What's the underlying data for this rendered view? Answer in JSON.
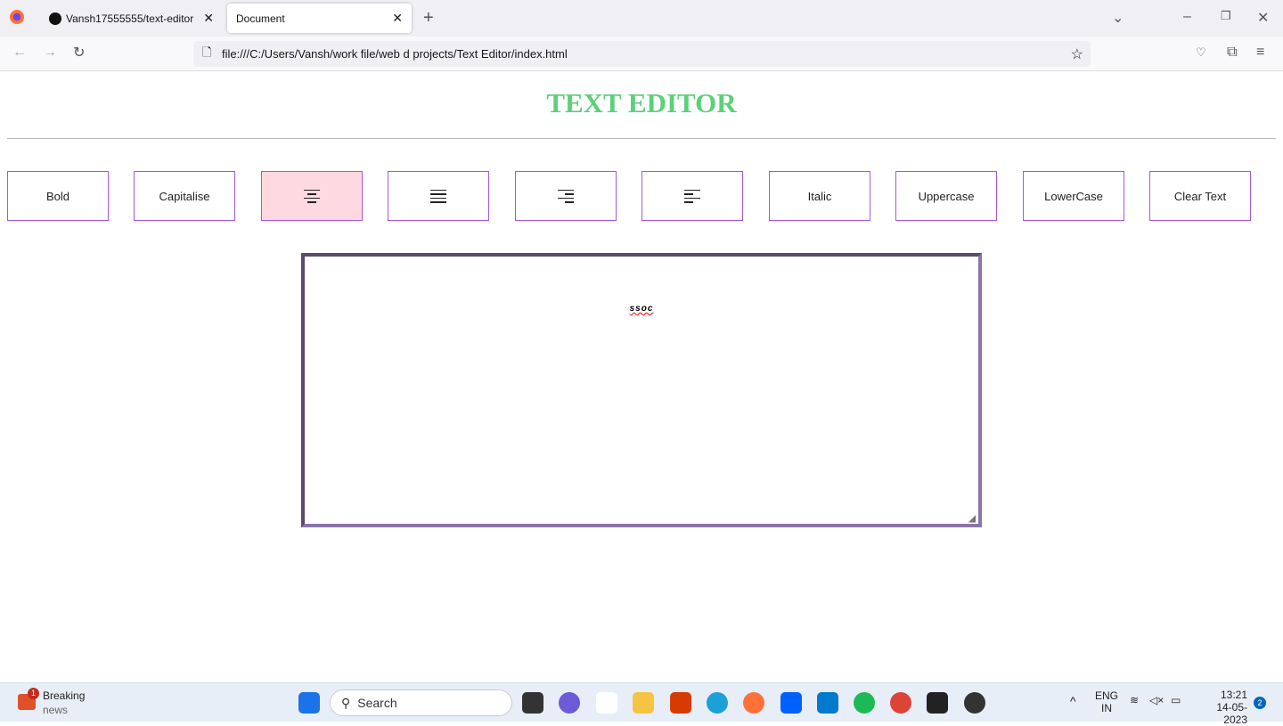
{
  "browser": {
    "tabs": [
      {
        "label": "Vansh17555555/text-editor"
      },
      {
        "label": "Document"
      }
    ],
    "url": "file:///C:/Users/Vansh/work file/web d projects/Text Editor/index.html"
  },
  "page": {
    "title": "TEXT EDITOR",
    "buttons": [
      {
        "label": "Bold"
      },
      {
        "label": "Capitalise"
      },
      {
        "label": "",
        "icon": "align-center-icon"
      },
      {
        "label": "",
        "icon": "align-justify-icon"
      },
      {
        "label": "",
        "icon": "align-right-icon"
      },
      {
        "label": "",
        "icon": "align-left-icon"
      },
      {
        "label": "Italic"
      },
      {
        "label": "Uppercase"
      },
      {
        "label": "LowerCase"
      },
      {
        "label": "Clear Text"
      }
    ],
    "active_color": "#ffd9e2",
    "title_color": "#5bd178",
    "textarea_value": "ssoc"
  },
  "taskbar": {
    "news_title": "Breaking",
    "news_sub": "news",
    "news_badge": "1",
    "search": "Search",
    "lang1": "ENG",
    "lang2": "IN",
    "time": "13:21",
    "date": "14-05-2023",
    "notif": "2"
  }
}
